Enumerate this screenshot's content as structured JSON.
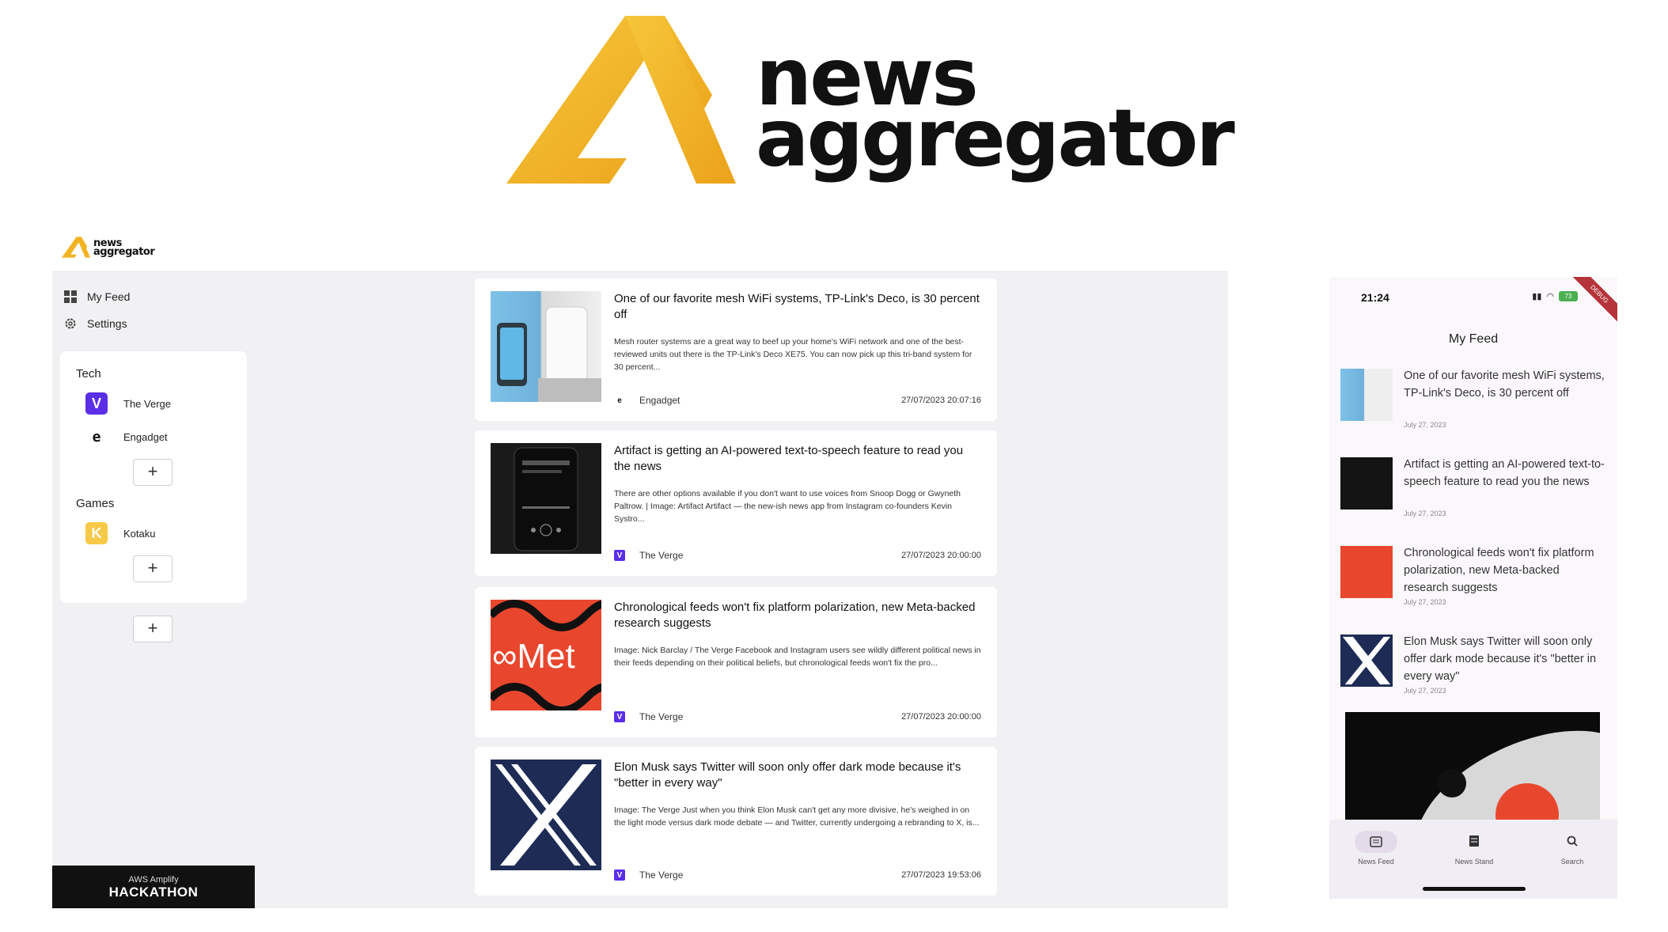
{
  "hero": {
    "word1": "news",
    "word2": "aggregator"
  },
  "desktop": {
    "logo": {
      "line1": "news",
      "line2": "aggregator"
    },
    "nav": [
      {
        "label": "My Feed",
        "icon": "grid-icon"
      },
      {
        "label": "Settings",
        "icon": "gear-icon"
      }
    ],
    "categories": [
      {
        "name": "Tech",
        "feeds": [
          {
            "name": "The Verge",
            "icon": "verge-icon"
          },
          {
            "name": "Engadget",
            "icon": "engadget-icon"
          }
        ]
      },
      {
        "name": "Games",
        "feeds": [
          {
            "name": "Kotaku",
            "icon": "kotaku-icon"
          }
        ]
      }
    ],
    "add_label": "+",
    "hackathon": {
      "line1": "AWS Amplify",
      "line2": "HACKATHON"
    },
    "articles": [
      {
        "title": "One of our favorite mesh WiFi systems, TP-Link's Deco, is 30 percent off",
        "description": "Mesh router systems are a great way to beef up your home's WiFi network and one of the best-reviewed units out there is the TP-Link's Deco XE75. You can now pick up this tri-band system for 30 percent...",
        "source": "Engadget",
        "date": "27/07/2023 20:07:16"
      },
      {
        "title": "Artifact is getting an AI-powered text-to-speech feature to read you the news",
        "description": "There are other options available if you don't want to use voices from Snoop Dogg or Gwyneth Paltrow. | Image: Artifact Artifact — the new-ish news app from Instagram co-founders Kevin Systro...",
        "source": "The Verge",
        "date": "27/07/2023 20:00:00"
      },
      {
        "title": "Chronological feeds won't fix platform polarization, new Meta-backed research suggests",
        "description": "Image: Nick Barclay / The Verge Facebook and Instagram users see wildly different political news in their feeds depending on their political beliefs, but chronological feeds won't fix the pro...",
        "source": "The Verge",
        "date": "27/07/2023 20:00:00"
      },
      {
        "title": "Elon Musk says Twitter will soon only offer dark mode because it's \"better in every way\"",
        "description": "Image: The Verge Just when you think Elon Musk can't get any more divisive, he's weighed in on the light mode versus dark mode debate — and Twitter, currently undergoing a rebranding to X, is...",
        "source": "The Verge",
        "date": "27/07/2023 19:53:06"
      }
    ]
  },
  "phone": {
    "time": "21:24",
    "battery": "73",
    "debug": "DEBUG",
    "title": "My Feed",
    "items": [
      {
        "title": "One of our favorite mesh WiFi systems, TP-Link's Deco, is 30 percent off",
        "date": "July 27, 2023"
      },
      {
        "title": "Artifact is getting an AI-powered text-to-speech feature to read you the news",
        "date": "July 27, 2023"
      },
      {
        "title": "Chronological feeds won't fix platform polarization, new Meta-backed research suggests",
        "date": "July 27, 2023"
      },
      {
        "title": "Elon Musk says Twitter will soon only offer dark mode because it's \"better in every way\"",
        "date": "July 27, 2023"
      }
    ],
    "bottom_nav": [
      {
        "label": "News Feed",
        "icon": "newspaper-icon",
        "active": true
      },
      {
        "label": "News Stand",
        "icon": "stand-icon",
        "active": false
      },
      {
        "label": "Search",
        "icon": "search-icon",
        "active": false
      }
    ]
  },
  "colors": {
    "brand_gold": "#f2b322",
    "brand_gold_dark": "#e8a317",
    "verge_purple": "#5b2ee8",
    "meta_red": "#e8472e",
    "x_navy": "#1d2b55"
  }
}
